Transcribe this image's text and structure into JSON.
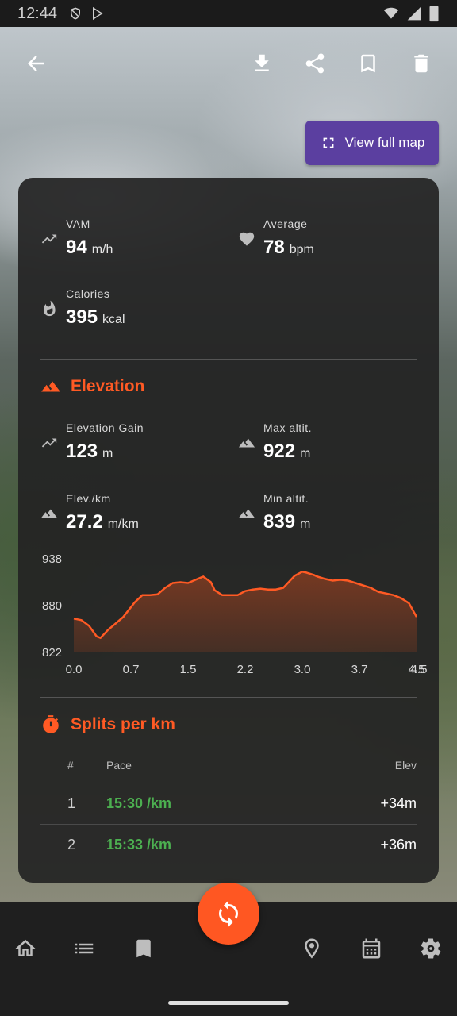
{
  "status_bar": {
    "time": "12:44"
  },
  "map": {
    "view_full_map_label": "View full map"
  },
  "stats": {
    "vam": {
      "label": "VAM",
      "value": "94",
      "unit": "m/h"
    },
    "average": {
      "label": "Average",
      "value": "78",
      "unit": "bpm"
    },
    "calories": {
      "label": "Calories",
      "value": "395",
      "unit": "kcal"
    }
  },
  "elevation": {
    "title": "Elevation",
    "gain": {
      "label": "Elevation Gain",
      "value": "123",
      "unit": "m"
    },
    "max_alt": {
      "label": "Max altit.",
      "value": "922",
      "unit": "m"
    },
    "elev_per_km": {
      "label": "Elev./km",
      "value": "27.2",
      "unit": "m/km"
    },
    "min_alt": {
      "label": "Min altit.",
      "value": "839",
      "unit": "m"
    }
  },
  "chart_data": {
    "type": "area",
    "y_ticks": [
      "938",
      "880",
      "822"
    ],
    "x_ticks": [
      "0.0",
      "0.7",
      "1.5",
      "2.2",
      "3.0",
      "3.7",
      "4.5",
      "4.5"
    ],
    "ylim": [
      822,
      938
    ],
    "xlim": [
      0,
      4.5
    ],
    "x": [
      0,
      0.1,
      0.2,
      0.3,
      0.35,
      0.45,
      0.55,
      0.65,
      0.8,
      0.9,
      1.0,
      1.1,
      1.2,
      1.3,
      1.4,
      1.5,
      1.6,
      1.7,
      1.8,
      1.85,
      1.95,
      2.05,
      2.15,
      2.25,
      2.35,
      2.45,
      2.55,
      2.65,
      2.75,
      2.9,
      3.0,
      3.05,
      3.15,
      3.2,
      3.3,
      3.4,
      3.5,
      3.6,
      3.7,
      3.8,
      3.9,
      4.0,
      4.1,
      4.2,
      4.3,
      4.4,
      4.5
    ],
    "y": [
      864,
      862,
      855,
      842,
      840,
      850,
      858,
      866,
      884,
      893,
      893,
      894,
      902,
      908,
      909,
      908,
      912,
      916,
      909,
      899,
      893,
      893,
      893,
      898,
      900,
      901,
      900,
      900,
      902,
      917,
      922,
      921,
      918,
      916,
      913,
      911,
      912,
      911,
      908,
      905,
      902,
      897,
      895,
      893,
      889,
      883,
      866
    ],
    "fill_color": "#7a3a22",
    "line_color": "#ff5a24"
  },
  "splits": {
    "title": "Splits per km",
    "headers": {
      "num": "#",
      "pace": "Pace",
      "elev": "Elev"
    },
    "rows": [
      {
        "num": "1",
        "pace": "15:30 /km",
        "elev": "+34m"
      },
      {
        "num": "2",
        "pace": "15:33 /km",
        "elev": "+36m"
      }
    ]
  },
  "colors": {
    "accent": "#ff5722",
    "map_button": "#5b3fa0",
    "pace_green": "#4caf50"
  }
}
